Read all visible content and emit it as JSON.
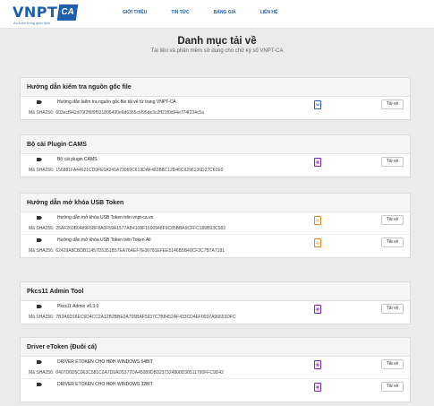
{
  "header": {
    "logo_text": "VNPT",
    "logo_box": "CA",
    "logo_tagline": "An toàn trong giao dịch",
    "nav": [
      "GIỚI THIỆU",
      "TIN TỨC",
      "BẢNG GIÁ",
      "LIÊN HỆ"
    ]
  },
  "hero": {
    "title": "Danh mục tải về",
    "subtitle": "Tài liệu và phần mềm sử dụng cho chữ ký số VNPT-CA"
  },
  "sha_label": "Mã SHA256:",
  "download_label": "Tải về",
  "sections": [
    {
      "title": "Hướng dẫn kiểm tra nguồn gốc file",
      "items": [
        {
          "title": "Hướng dẫn kiểm tra nguồn gốc file tải về từ trang VNPT-CA",
          "sha": "603ecf942d70f2f6f9f931806490e6d6365c6f95de3c2ff21f0d94e774f234c5a",
          "icon": "word-file-icon"
        }
      ]
    },
    {
      "title": "Bộ cài Plugin CAMS",
      "items": [
        {
          "title": "Bộ cài plugin CAMS",
          "sha": "156881FA44621CD9FE0A241A73069C619DAF482B8C12D46C9296136D27C61E0",
          "icon": "zip-file-icon"
        }
      ]
    },
    {
      "title": "Hướng dẫn mở khóa USB Token",
      "items": [
        {
          "title": "Hướng dẫn mở khóa USB Token trên vnpt-ca.vn",
          "sha": "25AF260B0489F5BF8A0F59A1577AB4108F1690948F9C85BBA9CFFC189B93C583",
          "icon": "pdf-file-icon"
        },
        {
          "title": "Hướng dẫn mở khóa USB Token trên Token.All",
          "sha": "62429A8CBDB11457D5351B57EA76AEF7E00781EFEE5146B5B40CF3C7B7A7181",
          "icon": "pdf-file-icon"
        }
      ]
    },
    {
      "title": "Pkcs11 Admin Tool",
      "items": [
        {
          "title": "Pkcs11 Admin v0.3.0",
          "sha": "7B2A6D16EC6D4CC2A12B2BBE0A705BAF5937C7B8452AF433CD4EF0937A96653DFC",
          "icon": "zip-file-icon"
        }
      ]
    },
    {
      "title": "Driver eToken (Đuôi cá)",
      "items": [
        {
          "title": "DRIVER ETOKEN CHO HĐH WINDOWS 64BIT",
          "sha": "0407D6D5C063C581C0A7D9AD5377DA45089DB3237324808D30511790FFC9D42",
          "icon": "zip-file-icon"
        },
        {
          "title": "DRIVER ETOKEN CHO HĐH WINDOWS 32BIT",
          "sha": "",
          "icon": "zip-file-icon"
        }
      ]
    }
  ]
}
